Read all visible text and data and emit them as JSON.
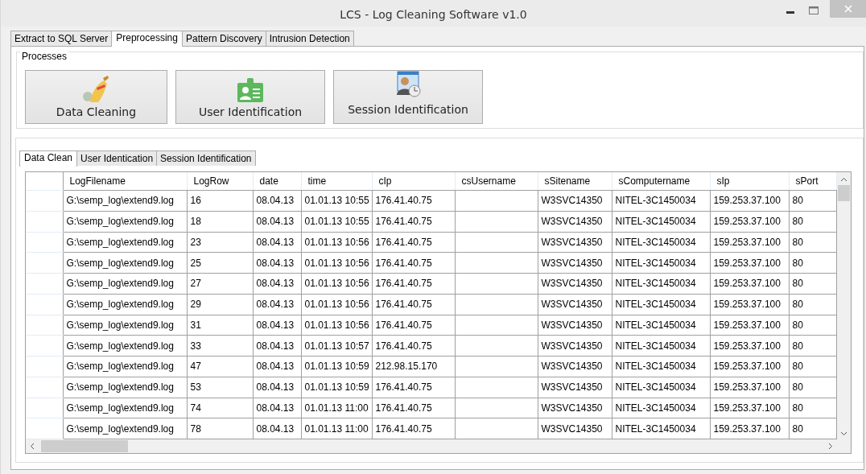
{
  "window": {
    "title": "LCS - Log Cleaning Software v1.0"
  },
  "tabs": [
    {
      "label": "Extract to SQL Server",
      "selected": false
    },
    {
      "label": "Preprocessing",
      "selected": true
    },
    {
      "label": "Pattern Discovery",
      "selected": false
    },
    {
      "label": "Intrusion Detection",
      "selected": false
    }
  ],
  "processes": {
    "title": "Processes",
    "buttons": [
      {
        "label": "Data Cleaning",
        "kind": "broom"
      },
      {
        "label": "User Identification",
        "kind": "card"
      },
      {
        "label": "Session Identification",
        "kind": "session"
      }
    ]
  },
  "result_tabs": [
    {
      "label": "Data Clean",
      "selected": true
    },
    {
      "label": "User Identication",
      "selected": false
    },
    {
      "label": "Session Identification",
      "selected": false
    }
  ],
  "table": {
    "columns": [
      "LogFilename",
      "LogRow",
      "date",
      "time",
      "cIp",
      "csUsername",
      "sSitename",
      "sComputername",
      "sIp",
      "sPort"
    ],
    "rows": [
      [
        "G:\\semp_log\\extend9.log",
        "16",
        "08.04.13",
        "01.01.13 10:55",
        "176.41.40.75",
        null,
        "W3SVC14350",
        "NITEL-3C1450034",
        "159.253.37.100",
        "80"
      ],
      [
        "G:\\semp_log\\extend9.log",
        "18",
        "08.04.13",
        "01.01.13 10:55",
        "176.41.40.75",
        null,
        "W3SVC14350",
        "NITEL-3C1450034",
        "159.253.37.100",
        "80"
      ],
      [
        "G:\\semp_log\\extend9.log",
        "23",
        "08.04.13",
        "01.01.13 10:56",
        "176.41.40.75",
        null,
        "W3SVC14350",
        "NITEL-3C1450034",
        "159.253.37.100",
        "80"
      ],
      [
        "G:\\semp_log\\extend9.log",
        "25",
        "08.04.13",
        "01.01.13 10:56",
        "176.41.40.75",
        null,
        "W3SVC14350",
        "NITEL-3C1450034",
        "159.253.37.100",
        "80"
      ],
      [
        "G:\\semp_log\\extend9.log",
        "27",
        "08.04.13",
        "01.01.13 10:56",
        "176.41.40.75",
        null,
        "W3SVC14350",
        "NITEL-3C1450034",
        "159.253.37.100",
        "80"
      ],
      [
        "G:\\semp_log\\extend9.log",
        "29",
        "08.04.13",
        "01.01.13 10:56",
        "176.41.40.75",
        null,
        "W3SVC14350",
        "NITEL-3C1450034",
        "159.253.37.100",
        "80"
      ],
      [
        "G:\\semp_log\\extend9.log",
        "31",
        "08.04.13",
        "01.01.13 10:56",
        "176.41.40.75",
        null,
        "W3SVC14350",
        "NITEL-3C1450034",
        "159.253.37.100",
        "80"
      ],
      [
        "G:\\semp_log\\extend9.log",
        "33",
        "08.04.13",
        "01.01.13 10:57",
        "176.41.40.75",
        null,
        "W3SVC14350",
        "NITEL-3C1450034",
        "159.253.37.100",
        "80"
      ],
      [
        "G:\\semp_log\\extend9.log",
        "47",
        "08.04.13",
        "01.01.13 10:59",
        "212.98.15.170",
        null,
        "W3SVC14350",
        "NITEL-3C1450034",
        "159.253.37.100",
        "80"
      ],
      [
        "G:\\semp_log\\extend9.log",
        "53",
        "08.04.13",
        "01.01.13 10:59",
        "176.41.40.75",
        null,
        "W3SVC14350",
        "NITEL-3C1450034",
        "159.253.37.100",
        "80"
      ],
      [
        "G:\\semp_log\\extend9.log",
        "74",
        "08.04.13",
        "01.01.13 11:00",
        "176.41.40.75",
        null,
        "W3SVC14350",
        "NITEL-3C1450034",
        "159.253.37.100",
        "80"
      ],
      [
        "G:\\semp_log\\extend9.log",
        "78",
        "08.04.13",
        "01.01.13 11:00",
        "176.41.40.75",
        null,
        "W3SVC14350",
        "NITEL-3C1450034",
        "159.253.37.100",
        "80"
      ]
    ]
  }
}
